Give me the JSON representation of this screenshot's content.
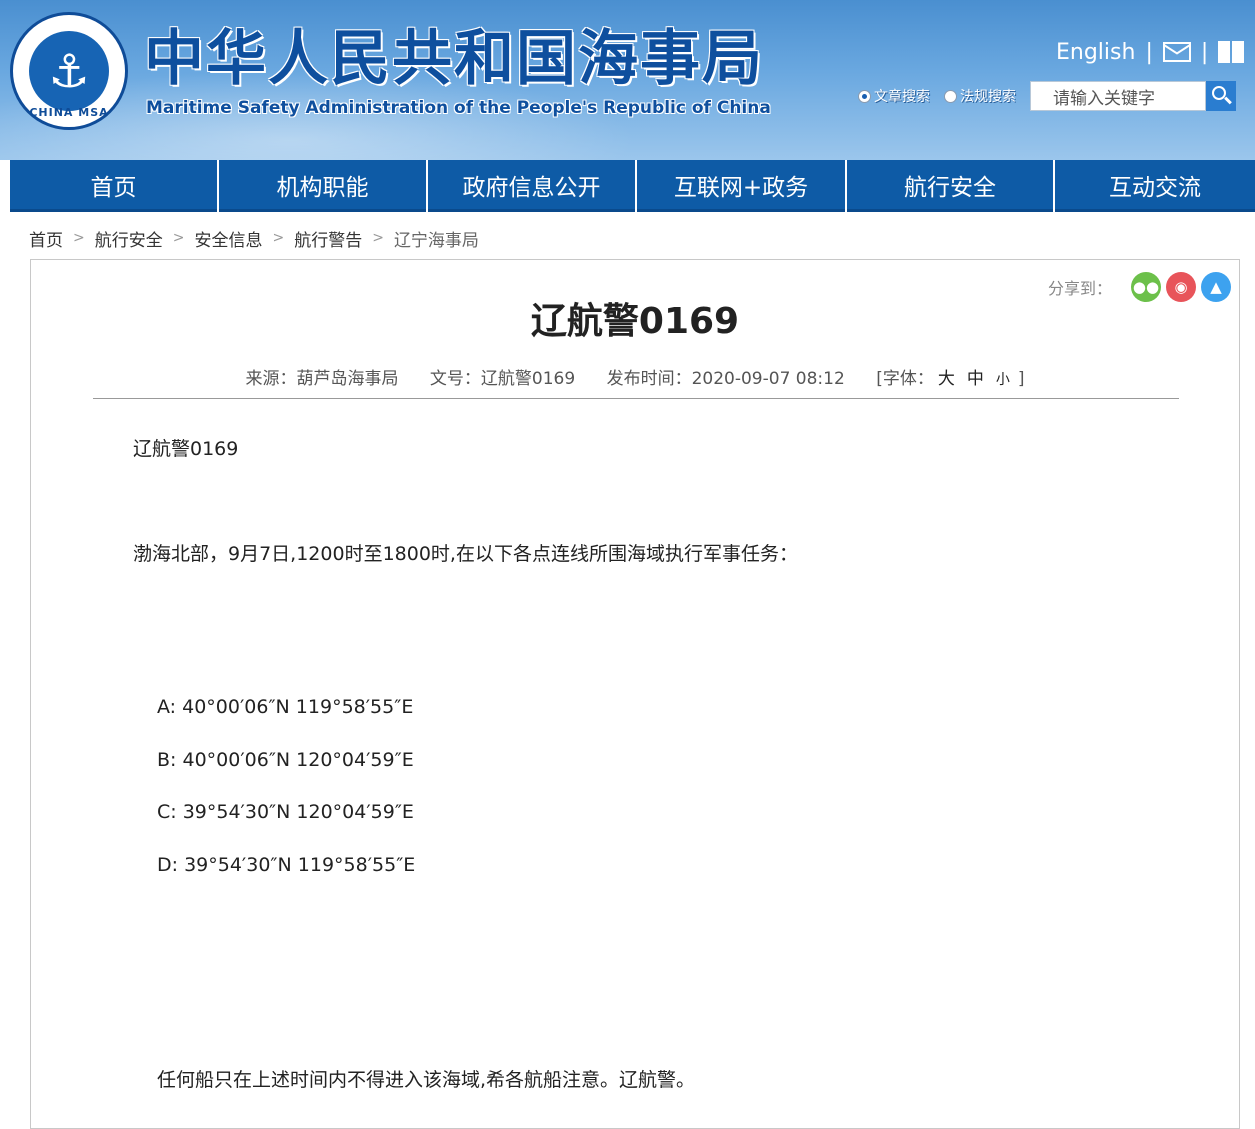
{
  "header": {
    "logo_text": "CHINA MSA",
    "title_cn": "中华人民共和国海事局",
    "title_en": "Maritime Safety Administration of the People's Republic of China",
    "english_link": "English",
    "search_options": [
      "文章搜索",
      "法规搜索"
    ],
    "search_placeholder": "请输入关键字"
  },
  "nav": [
    "首页",
    "机构职能",
    "政府信息公开",
    "互联网+政务",
    "航行安全",
    "互动交流"
  ],
  "breadcrumb": [
    "首页",
    "航行安全",
    "安全信息",
    "航行警告",
    "辽宁海事局"
  ],
  "share": {
    "label": "分享到：",
    "colors": {
      "wechat": "#6cc04a",
      "weibo": "#e8545a",
      "qq": "#3da2ef"
    }
  },
  "article": {
    "title": "辽航警0169",
    "source": "来源：葫芦岛海事局",
    "doc_no": "文号：辽航警0169",
    "published": "发布时间：2020-09-07 08:12",
    "font_size_label": "[字体：",
    "font_sizes": [
      "大",
      "中",
      "小"
    ],
    "font_size_end": "]",
    "para1": "辽航警0169",
    "para2": "渤海北部，9月7日,1200时至1800时,在以下各点连线所围海域执行军事任务：",
    "points": [
      "A: 40°00′06″N 119°58′55″E",
      "B: 40°00′06″N 120°04′59″E",
      "C: 39°54′30″N 120°04′59″E",
      "D: 39°54′30″N 119°58′55″E"
    ],
    "para3": "任何船只在上述时间内不得进入该海域,希各航船注意。辽航警。"
  }
}
